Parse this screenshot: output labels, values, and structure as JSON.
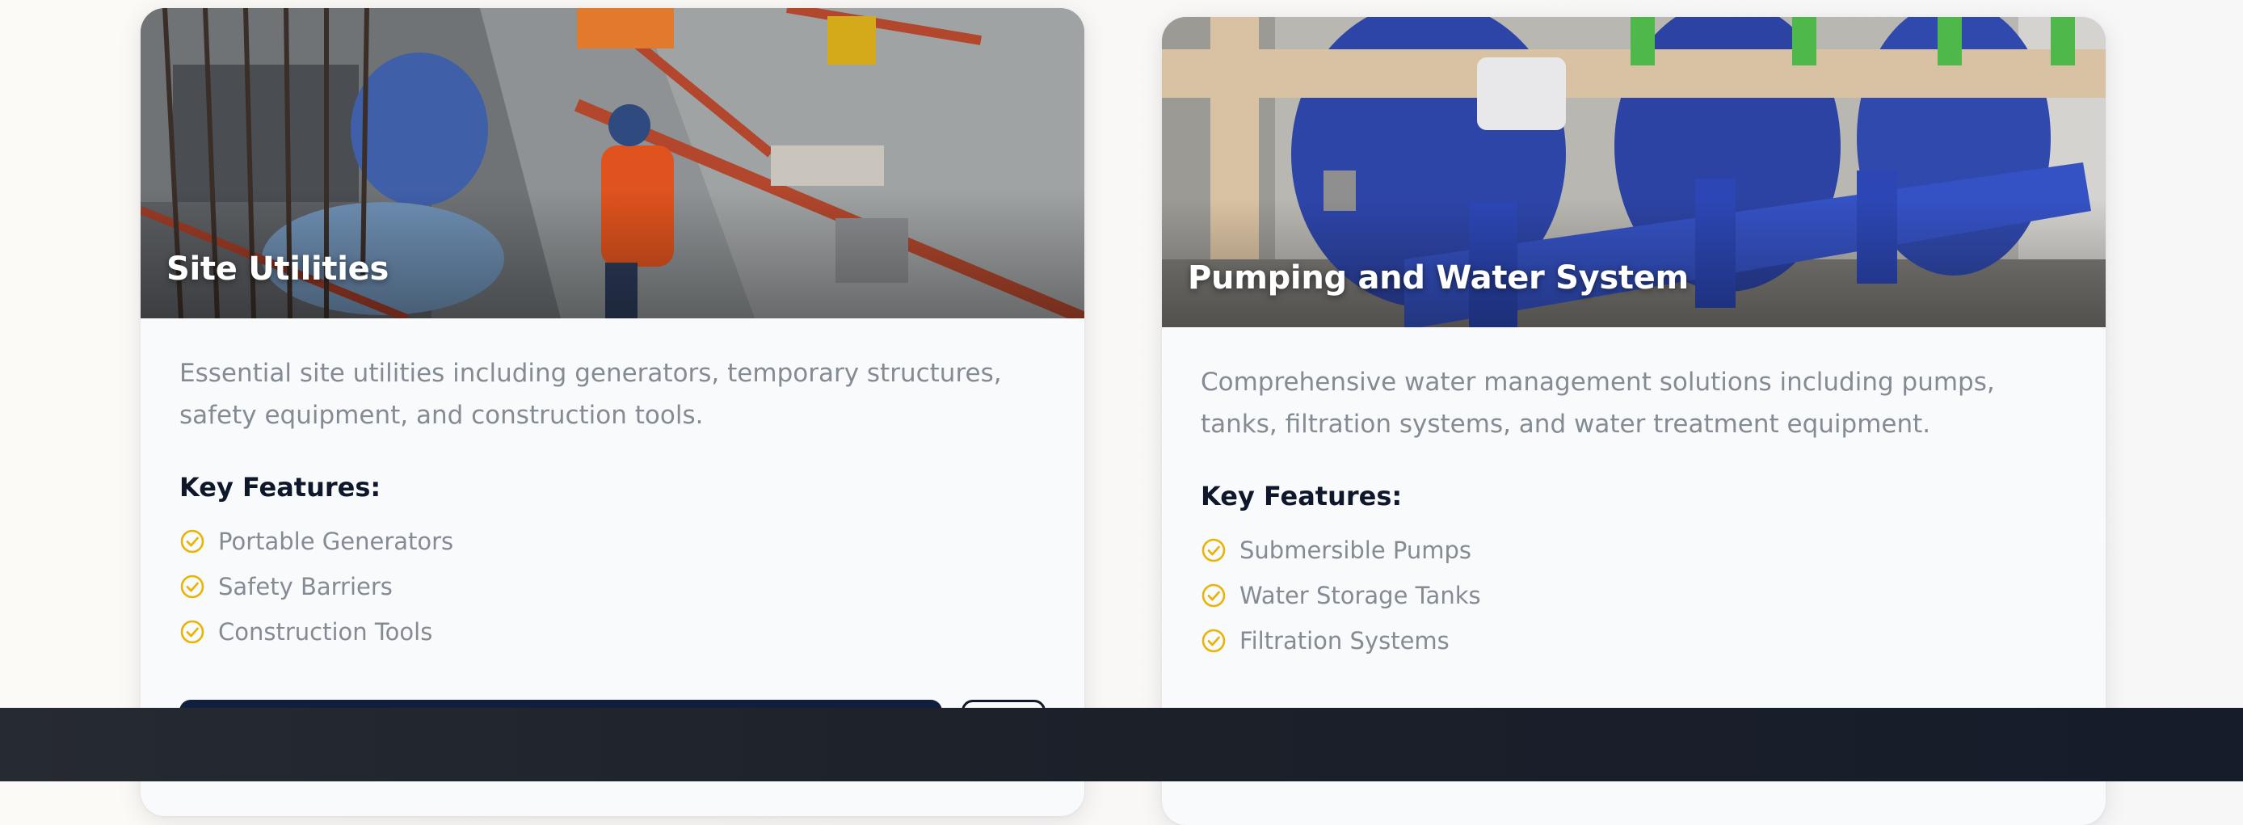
{
  "colors": {
    "accent": "#eab308",
    "heading": "#0f172a",
    "muted_text": "#858b93",
    "primary_button": "#0f1f3d",
    "footer": "#1c2029"
  },
  "cards": [
    {
      "title": "Site Utilities",
      "description": "Essential site utilities including generators, temporary structures, safety equipment, and construction tools.",
      "features_heading": "Key Features:",
      "features": [
        "Portable Generators",
        "Safety Barriers",
        "Construction Tools"
      ],
      "icon": "check-circle-icon"
    },
    {
      "title": "Pumping and Water System",
      "description": "Comprehensive water management solutions including pumps, tanks, filtration systems, and water treatment equipment.",
      "features_heading": "Key Features:",
      "features": [
        "Submersible Pumps",
        "Water Storage Tanks",
        "Filtration Systems"
      ],
      "icon": "check-circle-icon"
    }
  ]
}
